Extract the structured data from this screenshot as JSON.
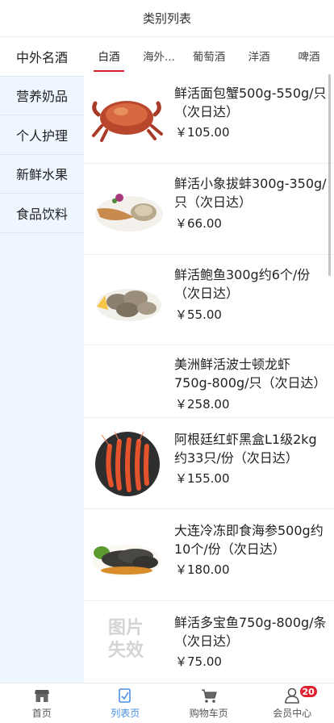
{
  "header": {
    "title": "类别列表"
  },
  "sidebar": {
    "items": [
      {
        "label": "中外名酒"
      },
      {
        "label": "营养奶品"
      },
      {
        "label": "个人护理"
      },
      {
        "label": "新鲜水果"
      },
      {
        "label": "食品饮料"
      }
    ]
  },
  "tabs": [
    {
      "label": "白酒"
    },
    {
      "label": "海外..."
    },
    {
      "label": "葡萄酒"
    },
    {
      "label": "洋酒"
    },
    {
      "label": "啤酒"
    }
  ],
  "products": [
    {
      "name": "鲜活面包蟹500g-550g/只（次日达）",
      "price": "￥105.00",
      "image": "crab"
    },
    {
      "name": "鲜活小象拔蚌300g-350g/只（次日达）",
      "price": "￥66.00",
      "image": "clam"
    },
    {
      "name": "鲜活鲍鱼300g约6个/份（次日达）",
      "price": "￥55.00",
      "image": "abalone"
    },
    {
      "name": "美洲鲜活波士顿龙虾750g-800g/只（次日达）",
      "price": "￥258.00",
      "image": "none"
    },
    {
      "name": "阿根廷红虾黑盒L1级2kg约33只/份（次日达）",
      "price": "￥155.00",
      "image": "shrimp"
    },
    {
      "name": "大连冷冻即食海参500g约10个/份（次日达）",
      "price": "￥180.00",
      "image": "sea-cucumber"
    },
    {
      "name": "鲜活多宝鱼750g-800g/条（次日达）",
      "price": "￥75.00",
      "image": "broken",
      "image_text": "图片失效"
    }
  ],
  "tabbar": {
    "items": [
      {
        "label": "首页",
        "icon": "store-icon"
      },
      {
        "label": "列表页",
        "icon": "list-icon"
      },
      {
        "label": "购物车页",
        "icon": "cart-icon"
      },
      {
        "label": "会员中心",
        "icon": "user-icon"
      }
    ],
    "cart_badge": "20"
  },
  "colors": {
    "accent": "#e0202e",
    "active_tab": "#4a90e2",
    "sidebar_bg": "#eef6ff"
  }
}
